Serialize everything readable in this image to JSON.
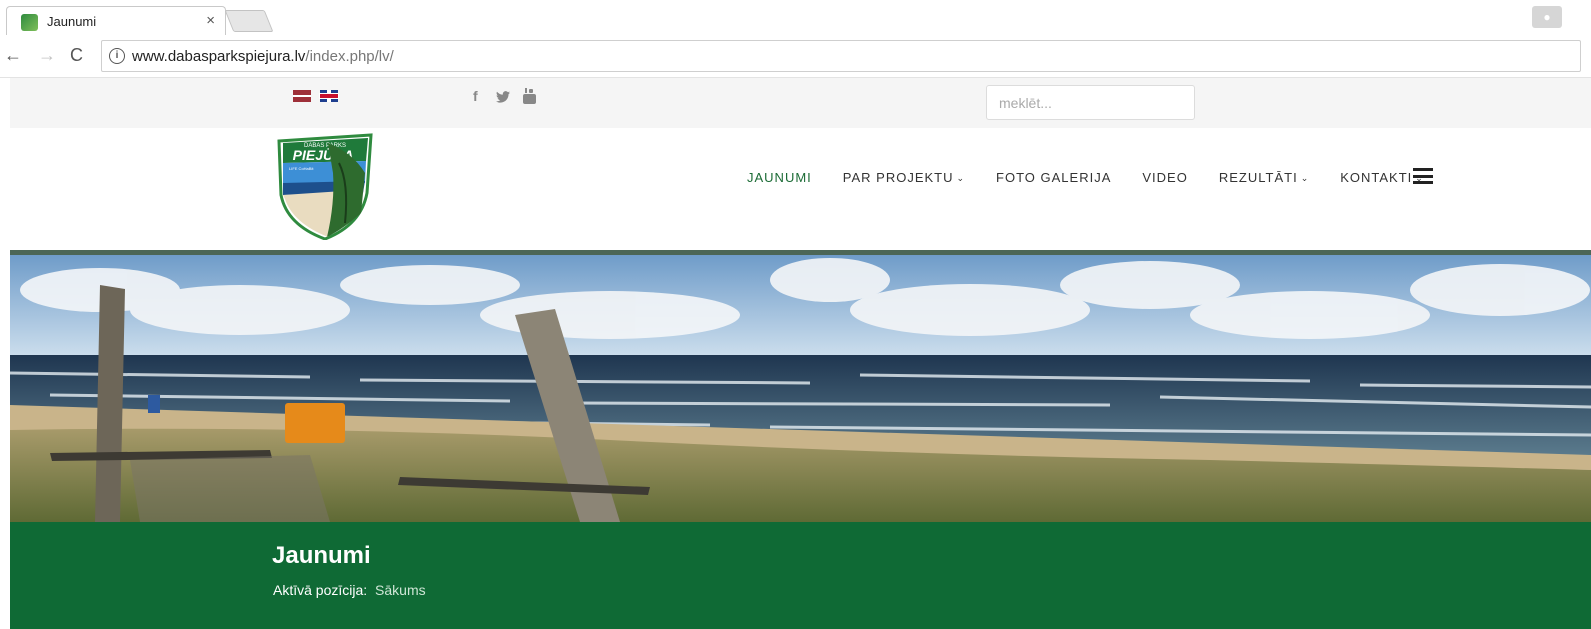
{
  "browser": {
    "tab_title": "Jaunumi",
    "tab_close": "×",
    "url_host": "www.dabasparkspiejura.lv",
    "url_path": "/index.php/lv/",
    "back_icon": "←",
    "forward_icon": "→",
    "reload_icon": "C",
    "info_icon": "i"
  },
  "topbar": {
    "languages": [
      "lv-flag-icon",
      "en-flag-icon"
    ],
    "social": {
      "facebook": "f",
      "twitter": "🐦",
      "youtube": "▣"
    },
    "search_placeholder": "meklēt..."
  },
  "logo": {
    "top_text": "DABAS PARKS",
    "name": "PIEJŪRA",
    "sub": "LIFE CoHaBit"
  },
  "menu": {
    "items": [
      {
        "label": "JAUNUMI",
        "active": true,
        "dropdown": false
      },
      {
        "label": "PAR PROJEKTU",
        "active": false,
        "dropdown": true
      },
      {
        "label": "FOTO GALERIJA",
        "active": false,
        "dropdown": false
      },
      {
        "label": "VIDEO",
        "active": false,
        "dropdown": false
      },
      {
        "label": "REZULTĀTI",
        "active": false,
        "dropdown": true
      },
      {
        "label": "KONTAKTI",
        "active": false,
        "dropdown": true
      }
    ],
    "chevron": "⌄"
  },
  "page": {
    "title": "Jaunumi",
    "breadcrumb_label": "Aktīvā pozīcija:",
    "breadcrumb_home": "Sākums"
  },
  "colors": {
    "accent_green": "#0f6a35",
    "menu_active": "#1b6b35",
    "divider": "#4c6656"
  }
}
